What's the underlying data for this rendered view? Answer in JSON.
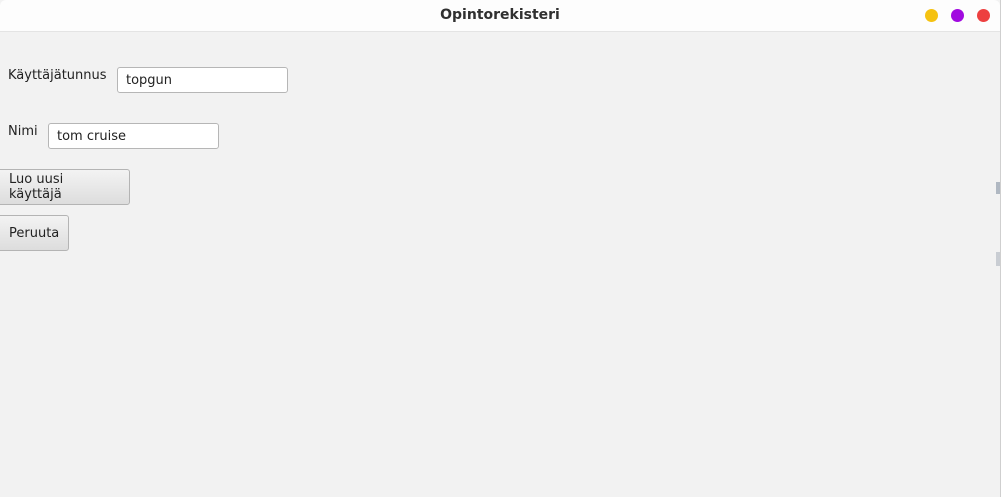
{
  "window": {
    "title": "Opintorekisteri",
    "controls": [
      {
        "name": "minimize",
        "color": "#f5c211"
      },
      {
        "name": "maximize",
        "color": "#a10ae0"
      },
      {
        "name": "close",
        "color": "#ed4040"
      }
    ]
  },
  "form": {
    "username_label": "Käyttäjätunnus",
    "username_value": "topgun",
    "name_label": "Nimi",
    "name_value": "tom cruise"
  },
  "buttons": {
    "create_label": "Luo uusi käyttäjä",
    "cancel_label": "Peruuta"
  }
}
